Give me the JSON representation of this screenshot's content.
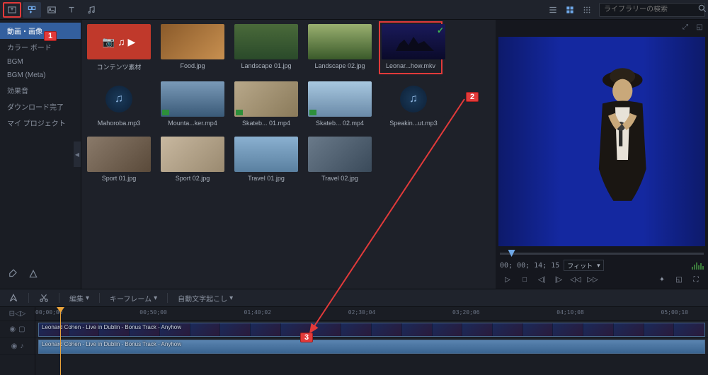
{
  "toolbar": {
    "search_placeholder": "ライブラリーの検索"
  },
  "sidebar": {
    "items": [
      {
        "label": "動画・画像"
      },
      {
        "label": "カラー ボード"
      },
      {
        "label": "BGM"
      },
      {
        "label": "BGM (Meta)"
      },
      {
        "label": "効果音"
      },
      {
        "label": "ダウンロード完了"
      },
      {
        "label": "マイ プロジェクト"
      }
    ]
  },
  "library": {
    "items": [
      {
        "label": "コンテンツ素材",
        "kind": "folder-red"
      },
      {
        "label": "Food.jpg",
        "kind": "photo-food"
      },
      {
        "label": "Landscape 01.jpg",
        "kind": "photo-forest"
      },
      {
        "label": "Landscape 02.jpg",
        "kind": "photo-trees"
      },
      {
        "label": "Leonar...how.mkv",
        "kind": "video-dark",
        "selected": true,
        "checked": true
      },
      {
        "label": "Mahoroba.mp3",
        "kind": "audio"
      },
      {
        "label": "Mounta...ker.mp4",
        "kind": "video-mountain",
        "badge": true
      },
      {
        "label": "Skateb... 01.mp4",
        "kind": "video-skate1",
        "badge": true
      },
      {
        "label": "Skateb... 02.mp4",
        "kind": "video-skate2",
        "badge": true
      },
      {
        "label": "Speakin...ut.mp3",
        "kind": "audio"
      },
      {
        "label": "Sport 01.jpg",
        "kind": "photo-sport1"
      },
      {
        "label": "Sport 02.jpg",
        "kind": "photo-sport2"
      },
      {
        "label": "Travel 01.jpg",
        "kind": "photo-travel1"
      },
      {
        "label": "Travel 02.jpg",
        "kind": "photo-travel2"
      }
    ]
  },
  "preview": {
    "timecode": "00; 00; 14; 15",
    "fit_label": "フィット",
    "fit_arrow": "▾"
  },
  "timeline_toolbar": {
    "edit": "編集",
    "keyframe": "キーフレーム",
    "auto_caption": "自動文字起こし",
    "arrow": "▾"
  },
  "timeline": {
    "ticks": [
      "00;00;00",
      "00;50;00",
      "01;40;02",
      "02;30;04",
      "03;20;06",
      "04;10;08",
      "05;00;10"
    ],
    "clip_title": "Leonard Cohen - Live in Dublin - Bonus Track - Anyhow",
    "audio_title": "Leonard Cohen - Live in Dublin - Bonus Track - Anyhow"
  },
  "annotations": {
    "a1": "1",
    "a2": "2",
    "a3": "3"
  }
}
